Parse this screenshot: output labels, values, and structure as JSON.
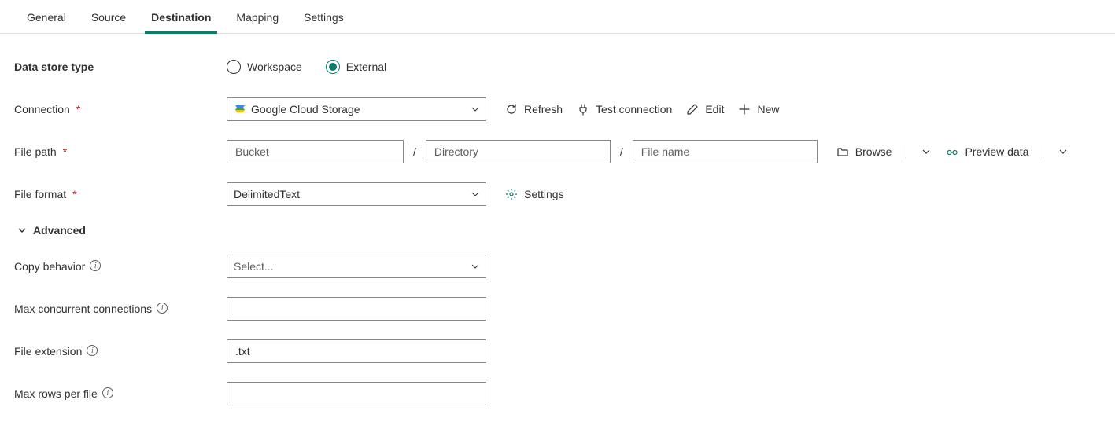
{
  "tabs": [
    {
      "label": "General"
    },
    {
      "label": "Source"
    },
    {
      "label": "Destination"
    },
    {
      "label": "Mapping"
    },
    {
      "label": "Settings"
    }
  ],
  "activeTab": "Destination",
  "labels": {
    "dataStoreType": "Data store type",
    "connection": "Connection",
    "filePath": "File path",
    "fileFormat": "File format",
    "advanced": "Advanced",
    "copyBehavior": "Copy behavior",
    "maxConcurrent": "Max concurrent connections",
    "fileExtension": "File extension",
    "maxRowsPerFile": "Max rows per file"
  },
  "dataStoreType": {
    "options": [
      "Workspace",
      "External"
    ],
    "selected": "External"
  },
  "connection": {
    "value": "Google Cloud Storage",
    "actions": {
      "refresh": "Refresh",
      "test": "Test connection",
      "edit": "Edit",
      "new": "New"
    }
  },
  "filePath": {
    "bucketPlaceholder": "Bucket",
    "directoryPlaceholder": "Directory",
    "fileNamePlaceholder": "File name",
    "bucket": "",
    "directory": "",
    "fileName": "",
    "actions": {
      "browse": "Browse",
      "preview": "Preview data"
    }
  },
  "fileFormat": {
    "value": "DelimitedText",
    "settingsLabel": "Settings"
  },
  "advanced": {
    "copyBehaviorPlaceholder": "Select...",
    "copyBehavior": "",
    "maxConcurrent": "",
    "fileExtension": ".txt",
    "maxRowsPerFile": ""
  }
}
